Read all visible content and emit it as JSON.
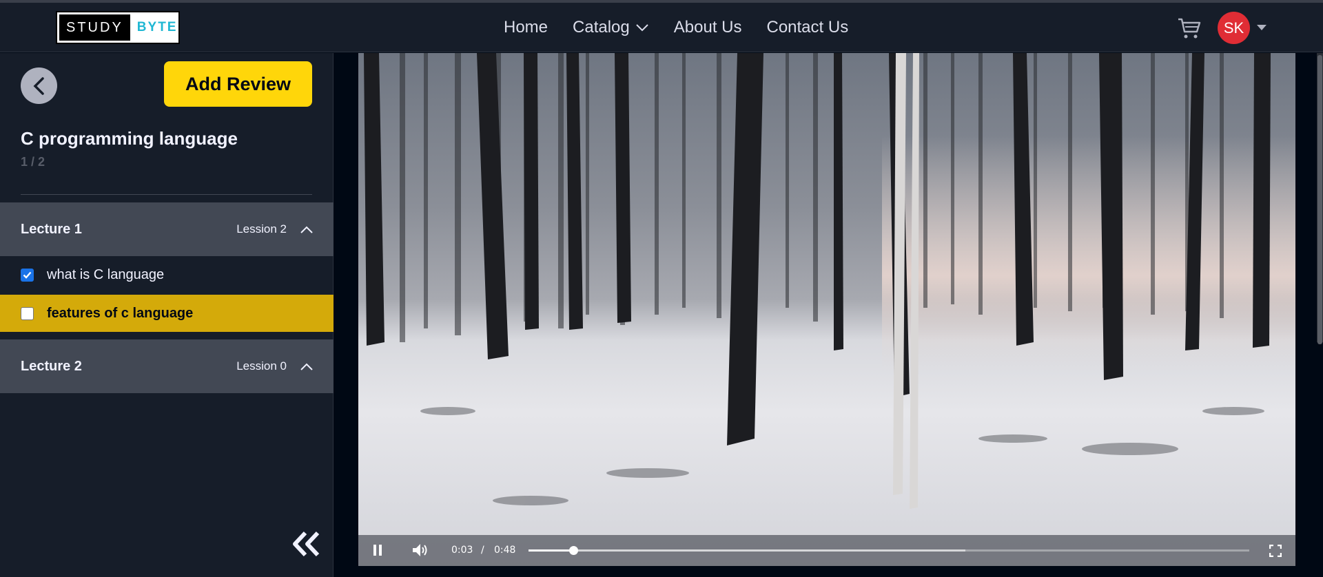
{
  "brand": {
    "study": "STUDY",
    "byte": "BYTE"
  },
  "nav": {
    "links": [
      "Home",
      "Catalog",
      "About Us",
      "Contact Us"
    ],
    "avatar_initials": "SK",
    "icons": [
      "cart-icon",
      "chevron-down-icon",
      "caret-down-icon"
    ]
  },
  "sidebar": {
    "add_review_label": "Add Review",
    "course_title": "C programming language",
    "progress": "1 / 2",
    "sections": [
      {
        "title": "Lecture 1",
        "lesson_count": "Lession 2",
        "lessons": [
          {
            "title": "what is C language",
            "completed": true,
            "active": false
          },
          {
            "title": "features of c language",
            "completed": false,
            "active": true
          }
        ]
      },
      {
        "title": "Lecture 2",
        "lesson_count": "Lession 0",
        "lessons": []
      }
    ]
  },
  "player": {
    "current_time": "0:03",
    "separator": "/",
    "duration": "0:48",
    "progress_fraction": 0.0625,
    "buffered_fraction": 0.606
  },
  "colors": {
    "accent_yellow": "#FFD60A",
    "active_lesson_bg": "#D4AA0A",
    "section_bg": "#424854",
    "avatar_red": "#E02D35",
    "logo_cyan": "#1FB7D3"
  }
}
